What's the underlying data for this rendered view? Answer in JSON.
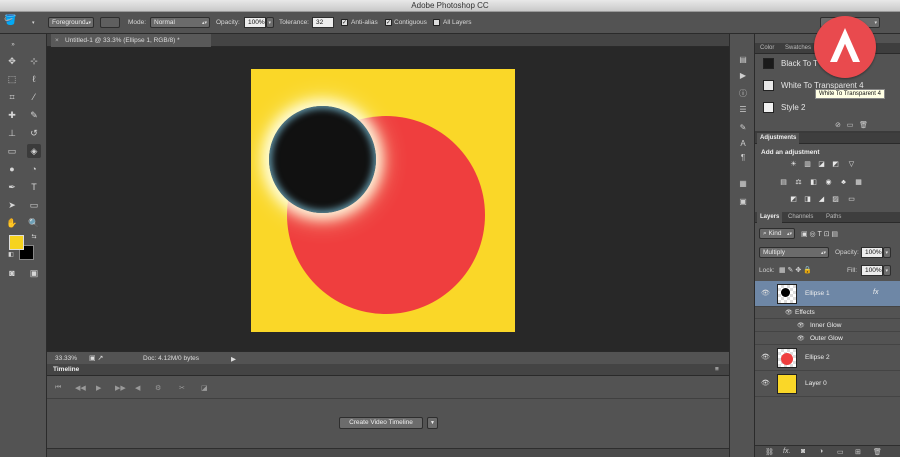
{
  "app": {
    "title": "Adobe Photoshop CC"
  },
  "options_bar": {
    "tool_preset": "Foreground",
    "mode_label": "Mode:",
    "mode_value": "Normal",
    "opacity_label": "Opacity:",
    "opacity_value": "100%",
    "tolerance_label": "Tolerance:",
    "tolerance_value": "32",
    "antialias_label": "Anti-alias",
    "contiguous_label": "Contiguous",
    "all_layers_label": "All Layers"
  },
  "document": {
    "tab_title": "Untitled-1 @ 33.3% (Ellipse 1, RGB/8) *",
    "zoom": "33.33%",
    "doc_info": "Doc: 4.12M/0 bytes",
    "artboard_color": "#fad728",
    "ellipse1_color": "#111111",
    "ellipse2_color": "#ef3e3e"
  },
  "timeline": {
    "title": "Timeline",
    "create_button": "Create Video Timeline"
  },
  "styles_panel": {
    "tabs": [
      "Color",
      "Swatches"
    ],
    "items": [
      {
        "label": "Black To T",
        "swatch": "#1a1a1a"
      },
      {
        "label": "White To Transparent 4",
        "swatch": "#e8e8e8"
      },
      {
        "label": "Style 2",
        "swatch": "#f0f0f0"
      }
    ],
    "tooltip": "White To Transparent 4"
  },
  "adjustments_panel": {
    "title": "Adjustments",
    "subtitle": "Add an adjustment"
  },
  "layers_panel": {
    "tabs": [
      "Layers",
      "Channels",
      "Paths"
    ],
    "filter_kind": "Kind",
    "blend_mode": "Multiply",
    "opacity_label": "Opacity:",
    "opacity_value": "100%",
    "lock_label": "Lock:",
    "fill_label": "Fill:",
    "fill_value": "100%",
    "layers": [
      {
        "name": "Ellipse 1",
        "selected": true,
        "fx": "fx"
      },
      {
        "name": "Ellipse 2",
        "selected": false
      },
      {
        "name": "Layer 0",
        "selected": false
      }
    ],
    "effects_label": "Effects",
    "effects": [
      "Inner Glow",
      "Outer Glow"
    ],
    "footer_fx": "fx."
  },
  "colors": {
    "foreground": "#f6d31e",
    "background": "#000000",
    "accent_logo": "#e94a4e"
  }
}
